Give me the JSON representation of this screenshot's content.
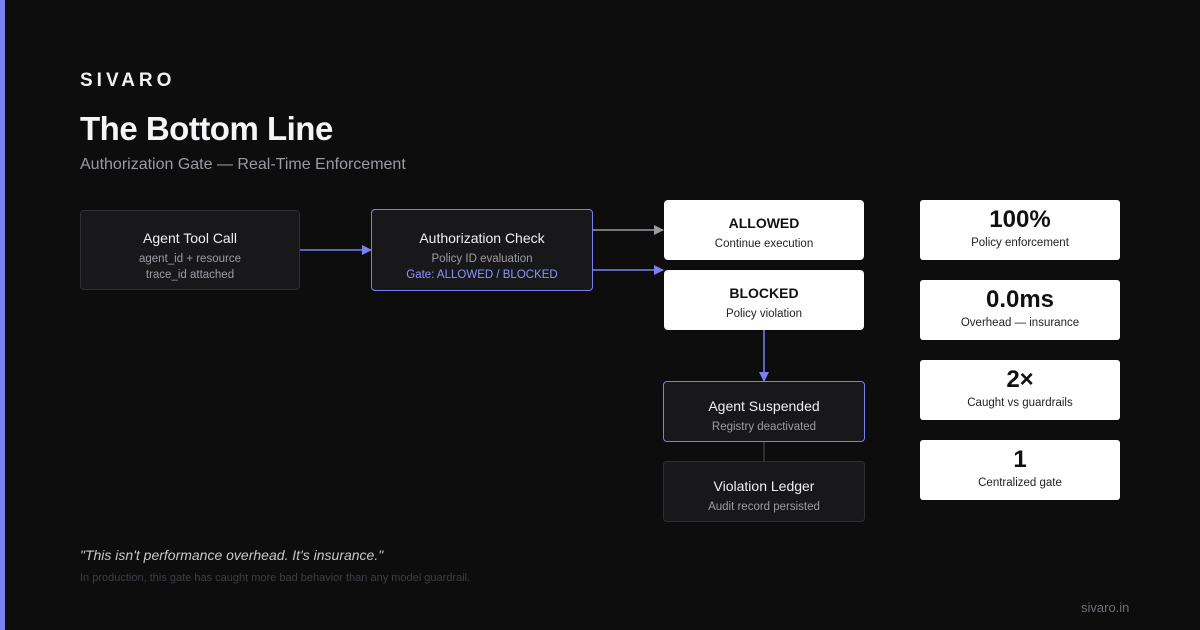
{
  "brand": "SIVARO",
  "title": "The Bottom Line",
  "subtitle": "Authorization Gate — Real-Time Enforcement",
  "colors": {
    "accent": "#7b80f0",
    "background": "#0d0d0e",
    "card_light": "#ffffff"
  },
  "nodes": {
    "tool_call": {
      "title": "Agent Tool Call",
      "line1": "agent_id + resource",
      "line2": "trace_id attached"
    },
    "auth_check": {
      "title": "Authorization Check",
      "line1": "Policy ID evaluation",
      "line2": "Gate: ALLOWED / BLOCKED"
    },
    "allowed": {
      "title": "ALLOWED",
      "line1": "Continue execution"
    },
    "blocked": {
      "title": "BLOCKED",
      "line1": "Policy violation"
    },
    "suspended": {
      "title": "Agent Suspended",
      "line1": "Registry deactivated"
    },
    "ledger": {
      "title": "Violation Ledger",
      "line1": "Audit record persisted"
    }
  },
  "stats": [
    {
      "value": "100%",
      "label": "Policy enforcement"
    },
    {
      "value": "0.0ms",
      "label": "Overhead — insurance"
    },
    {
      "value": "2×",
      "label": "Caught vs guardrails"
    },
    {
      "value": "1",
      "label": "Centralized gate"
    }
  ],
  "quote": "\"This isn't performance overhead. It's insurance.\"",
  "note": "In production, this gate has caught more bad behavior than any model guardrail.",
  "url": "sivaro.in"
}
